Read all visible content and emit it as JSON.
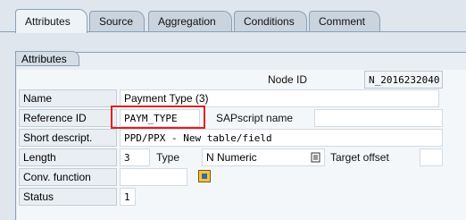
{
  "tabs": [
    {
      "label": "Attributes",
      "active": true
    },
    {
      "label": "Source"
    },
    {
      "label": "Aggregation"
    },
    {
      "label": "Conditions"
    },
    {
      "label": "Comment"
    }
  ],
  "group_title": "Attributes",
  "node_id": {
    "label": "Node ID",
    "value": "N_2016232040"
  },
  "name": {
    "label": "Name",
    "value": "Payment Type (3)"
  },
  "reference_id": {
    "label": "Reference ID",
    "value": "PAYM_TYPE"
  },
  "sapscript_name": {
    "label": "SAPscript name",
    "value": ""
  },
  "short_descript": {
    "label": "Short descript.",
    "value": "PPD/PPX - New table/field"
  },
  "length": {
    "label": "Length",
    "value": "3"
  },
  "type": {
    "label": "Type",
    "value": "N Numeric"
  },
  "target_offset": {
    "label": "Target offset",
    "value": ""
  },
  "conv_function": {
    "label": "Conv. function",
    "value": ""
  },
  "status": {
    "label": "Status",
    "value": "1"
  },
  "colors": {
    "highlight": "#e02020",
    "background": "#dfe6ee"
  }
}
